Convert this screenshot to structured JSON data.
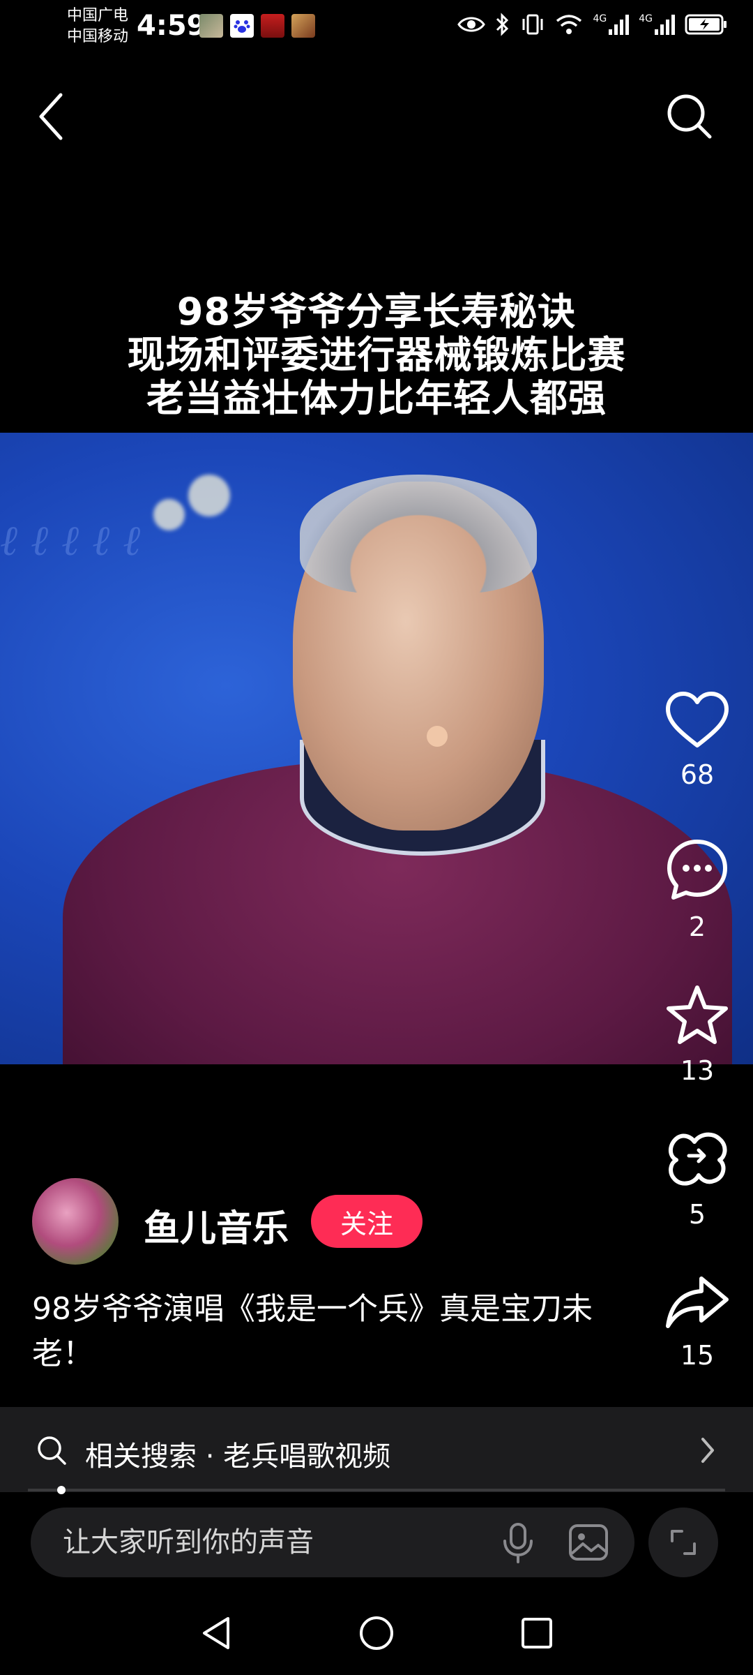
{
  "status_bar": {
    "carrier_1": "中国广电",
    "carrier_2": "中国移动",
    "time": "4:59",
    "network_1": "4G",
    "network_2": "4G"
  },
  "header": {
    "back_icon": "chevron-left-icon",
    "search_icon": "search-icon"
  },
  "video": {
    "caption_lines": [
      "98岁爷爷分享长寿秘诀",
      "现场和评委进行器械锻炼比赛",
      "老当益壮体力比年轻人都强"
    ]
  },
  "actions": {
    "like_count": "68",
    "comment_count": "2",
    "favorite_count": "13",
    "share_friend_count": "5",
    "share_count": "15"
  },
  "author": {
    "name": "鱼儿音乐",
    "follow_label": "关注"
  },
  "post": {
    "description": "98岁爷爷演唱《我是一个兵》真是宝刀未老！"
  },
  "related_search": {
    "text": "相关搜索 · 老兵唱歌视频"
  },
  "comment_box": {
    "placeholder": "让大家听到你的声音"
  },
  "colors": {
    "accent": "#fe2c55",
    "background": "#000000"
  }
}
